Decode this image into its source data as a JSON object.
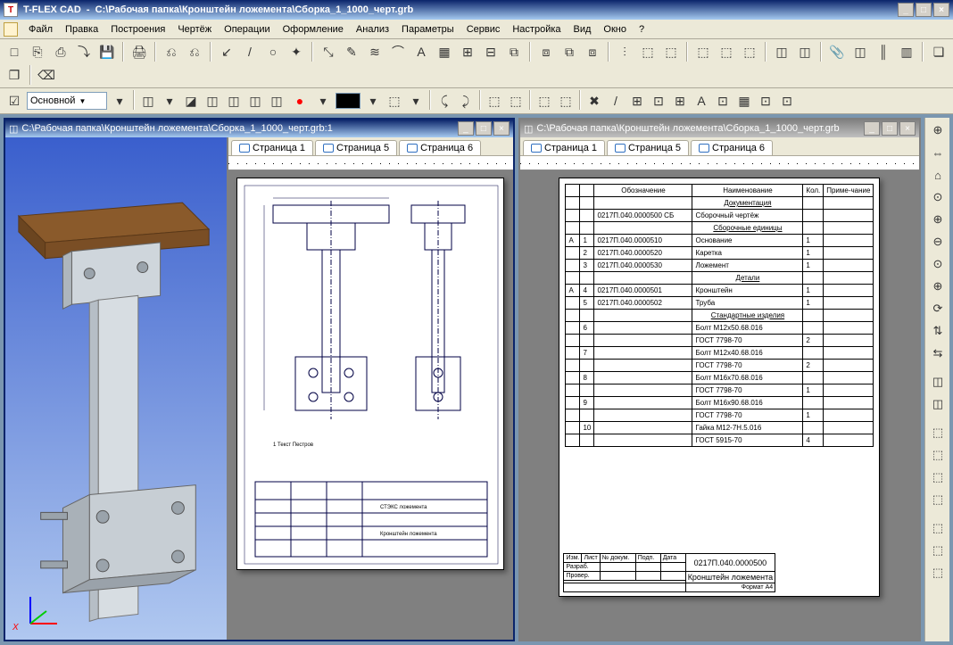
{
  "app": {
    "name": "T-FLEX CAD",
    "document_path": "С:\\Рабочая папка\\Кронштейн ложемента\\Сборка_1_1000_черт.grb"
  },
  "window_buttons": {
    "min": "_",
    "max": "□",
    "close": "×"
  },
  "menu": {
    "items": [
      "Файл",
      "Правка",
      "Построения",
      "Чертёж",
      "Операции",
      "Оформление",
      "Анализ",
      "Параметры",
      "Сервис",
      "Настройка",
      "Вид",
      "Окно",
      "?"
    ]
  },
  "toolbar1": {
    "icons": [
      "□",
      "⎘",
      "⎙",
      "⤵",
      "💾",
      "│",
      "🖨",
      "│",
      "⎌",
      "⎌",
      "│",
      "↙",
      "/",
      "○",
      "✦",
      "│",
      "⤡",
      "✎",
      "≋",
      "⌒",
      "A",
      "▦",
      "⊞",
      "⊟",
      "⧉",
      "│",
      "⧈",
      "⧉",
      "⧈",
      "│",
      "⫶",
      "⬚",
      "⬚",
      "│",
      "⬚",
      "⬚",
      "⬚",
      "│",
      "◫",
      "◫",
      "│",
      "📎",
      "◫",
      "║",
      "▥",
      "│",
      "❏",
      "❐",
      "│",
      "⌫"
    ]
  },
  "toolbar2": {
    "layer_check_icon": "☑",
    "layer_combo": "Основной",
    "icons_a": [
      "▾",
      "│",
      "◫",
      "▾",
      "◪",
      "◫",
      "◫",
      "◫",
      "◫"
    ],
    "icons_b": [
      "●",
      "▾"
    ],
    "icons_after_color": [
      "▾",
      "⬚",
      "▾",
      "│",
      "⤹",
      "⤸",
      "│",
      "⬚",
      "⬚",
      "│",
      "⬚",
      "⬚",
      "│",
      "✖",
      "/",
      "⊞",
      "⊡",
      "⊞",
      "A",
      "⊡",
      "▦",
      "⊡",
      "⊡"
    ]
  },
  "mdi1": {
    "title": "С:\\Рабочая папка\\Кронштейн ложемента\\Сборка_1_1000_черт.grb:1",
    "tabs": [
      "Страница 1",
      "Страница 5",
      "Страница 6"
    ],
    "drawing": {
      "note": "1 Текст Пестров",
      "titleblock_main": "Кронштейн ложемента",
      "titleblock_sub": "СТЭКС ложемента"
    }
  },
  "mdi2": {
    "title": "С:\\Рабочая папка\\Кронштейн ложемента\\Сборка_1_1000_черт.grb",
    "tabs": [
      "Страница 1",
      "Страница 5",
      "Страница 6"
    ],
    "bom": {
      "headers": {
        "col1": "",
        "col2": "Обозначение",
        "col3": "Наименование",
        "col4": "Кол.",
        "col5": "Приме-чание"
      },
      "sections": {
        "doc": "Документация",
        "sbedin": "Сборочные единицы",
        "detail": "Детали",
        "std": "Стандартные изделия"
      },
      "rows": [
        {
          "n": "",
          "ref": "0217П.040.0000500 СБ",
          "name": "Сборочный чертёж",
          "q": ""
        },
        {
          "n": "1",
          "ref": "0217П.040.0000510",
          "name": "Основание",
          "q": "1"
        },
        {
          "n": "2",
          "ref": "0217П.040.0000520",
          "name": "Каретка",
          "q": "1"
        },
        {
          "n": "3",
          "ref": "0217П.040.0000530",
          "name": "Ложемент",
          "q": "1"
        },
        {
          "n": "4",
          "ref": "0217П.040.0000501",
          "name": "Кронштейн",
          "q": "1"
        },
        {
          "n": "5",
          "ref": "0217П.040.0000502",
          "name": "Труба",
          "q": "1"
        },
        {
          "n": "6",
          "ref": "",
          "name": "Болт М12х50.68.016",
          "q": ""
        },
        {
          "n": "",
          "ref": "",
          "name": "ГОСТ 7798-70",
          "q": "2"
        },
        {
          "n": "7",
          "ref": "",
          "name": "Болт М12х40.68.016",
          "q": ""
        },
        {
          "n": "",
          "ref": "",
          "name": "ГОСТ 7798-70",
          "q": "2"
        },
        {
          "n": "8",
          "ref": "",
          "name": "Болт М16х70.68.016",
          "q": ""
        },
        {
          "n": "",
          "ref": "",
          "name": "ГОСТ 7798-70",
          "q": "1"
        },
        {
          "n": "9",
          "ref": "",
          "name": "Болт М16х90.68.016",
          "q": ""
        },
        {
          "n": "",
          "ref": "",
          "name": "ГОСТ 7798-70",
          "q": "1"
        },
        {
          "n": "10",
          "ref": "",
          "name": "Гайка М12-7Н.5.016",
          "q": ""
        },
        {
          "n": "",
          "ref": "",
          "name": "ГОСТ 5915-70",
          "q": "4"
        }
      ],
      "title_code": "0217П.040.0000500",
      "title_name": "Кронштейн ложемента",
      "tb_labels": {
        "izm": "Изм.",
        "list": "Лист",
        "ndok": "№ докум.",
        "podp": "Подп.",
        "data": "Дата",
        "razrab": "Разраб.",
        "prov": "Провер.",
        "format": "Формат А4"
      }
    }
  },
  "side_tools": [
    "⊕",
    "⇔",
    "⌂",
    "⊙",
    "⊕",
    "⊖",
    "⊙",
    "⊕",
    "⟳",
    "⇅",
    "⇆",
    "│",
    "◫",
    "◫",
    "│",
    "⬚",
    "⬚",
    "⬚",
    "⬚",
    "│",
    "⬚",
    "⬚",
    "⬚"
  ]
}
